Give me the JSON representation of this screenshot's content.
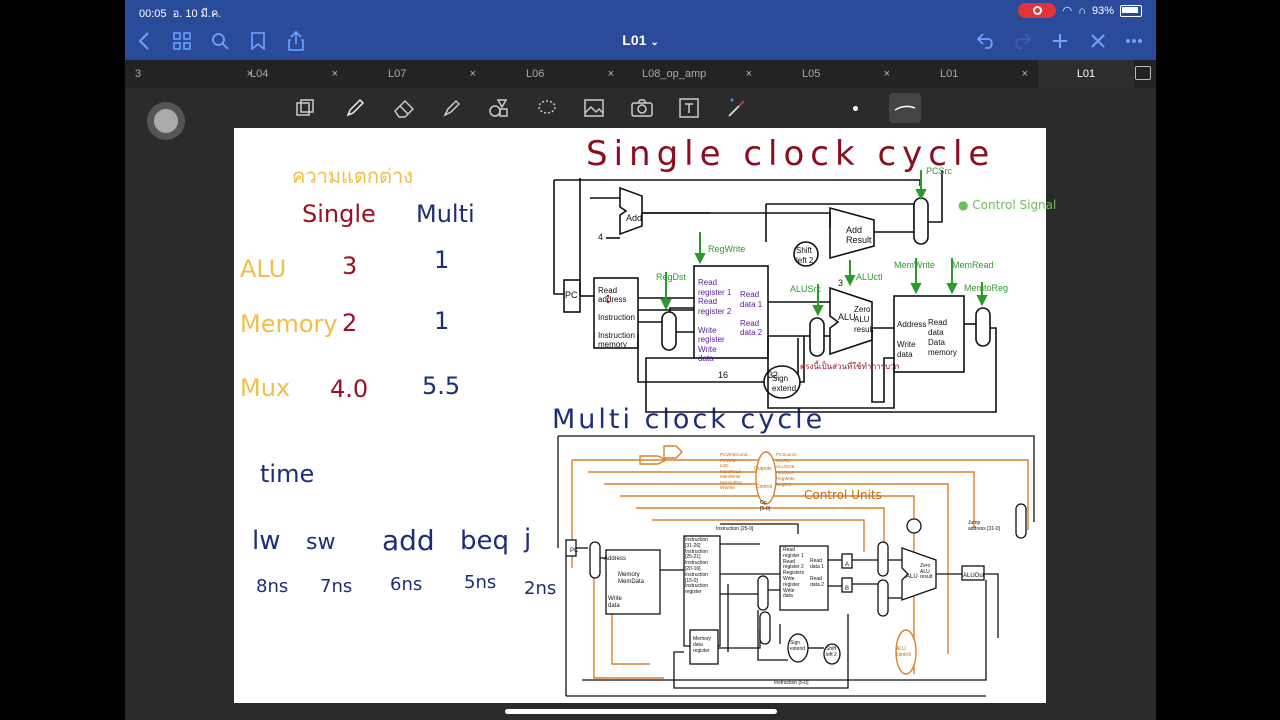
{
  "status": {
    "time": "00:05",
    "date": "อ. 10 มี.ค.",
    "battery": "93%"
  },
  "nav": {
    "doc_title": "L01",
    "chevron": "⌄"
  },
  "tabs": [
    {
      "label": "3",
      "close": "×"
    },
    {
      "label": "L04",
      "close": "×"
    },
    {
      "label": "L07",
      "close": "×"
    },
    {
      "label": "L06",
      "close": "×"
    },
    {
      "label": "L08_op_amp",
      "close": "×"
    },
    {
      "label": "L05",
      "close": "×"
    },
    {
      "label": "L01",
      "close": "×"
    },
    {
      "label": "L01",
      "close": ""
    }
  ],
  "notes": {
    "heading_th": "ความแตกต่าง",
    "col_single": "Single",
    "col_multi": "Multi",
    "rows": [
      {
        "name": "ALU",
        "single": "3",
        "multi": "1"
      },
      {
        "name": "Memory",
        "single": "2",
        "multi": "1"
      },
      {
        "name": "Mux",
        "single": "4.0",
        "multi": "5.5"
      }
    ],
    "time_label": "time",
    "instructions": [
      "lw",
      "sw",
      "add",
      "beq",
      "j"
    ],
    "times": [
      "8ns",
      "7ns",
      "6ns",
      "5ns",
      "2ns"
    ],
    "single_title": "Single  clock  cycle",
    "multi_title": "Multi  clock  cycle",
    "control_signal": "Control Signal",
    "control_units": "Control Units",
    "alu_note": "ตรงนี้เป็นส่วนที่ใช้ทำการบวก"
  },
  "single_diagram": {
    "signals": [
      "PCSrc",
      "RegWrite",
      "RegDst",
      "ALUSrc",
      "ALUctl",
      "MemWrite",
      "MemRead",
      "MemtoReg"
    ],
    "blocks": {
      "add": "Add",
      "add_result": "Add\nResult",
      "shift": "Shift\nleft 2",
      "pc": "PC",
      "inst_mem": "Read\naddress\n\nInstruction\n\nInstruction\nmemory",
      "regs_left": "Read\nregister 1\nRead\nregister 2\n\nWrite\nregister\nWrite\ndata",
      "regs_right": "Read\ndata 1\n\nRead\ndata 2",
      "alu": "ALU",
      "zero": "Zero\nALU\nresult",
      "data_mem": "Address\n\nWrite\ndata",
      "data_mem_r": "Read\ndata\nData\nmemory",
      "sign": "Sign\nextend",
      "mux": "Mux",
      "four": "4",
      "three": "3",
      "sixteen": "16",
      "thirtytwo": "32"
    }
  },
  "multi_diagram": {
    "labels": {
      "memory": "Memory\nMemData",
      "address": "Address",
      "write_data": "Write\ndata",
      "instr_reg": "Instruction\n[31-26]\nInstruction\n[25-21]\nInstruction\n[20-16]\nInstruction\n[15-0]\nInstruction\nregister",
      "registers": "Read\nregister 1\nRead\nregister 2\nRegisters\nWrite\nregister\nWrite\ndata",
      "read_data": "Read\ndata 1\n\nRead\ndata 2",
      "a": "A",
      "b": "B",
      "alu": "ALU",
      "zero": "Zero\nALU\nresult",
      "aluout": "ALUOut",
      "mdr": "Memory\ndata\nregister",
      "sign": "Sign\nextend",
      "shift": "Shift\nleft 2",
      "alu_control": "ALU\ncontrol",
      "jump": "Jump\naddress [31-0]",
      "outputs": "Outputs",
      "control": "Control",
      "op": "Op\n[5-0]",
      "instr_2500": "Instruction [25-0]",
      "instr_50": "Instruction [5-0]",
      "pc": "PC",
      "ctrl_left": [
        "PCWriteCond",
        "PCWrite",
        "IorD",
        "MemRead",
        "MemWrite",
        "MemtoReg",
        "IRWrite"
      ],
      "ctrl_right": [
        "PCSource",
        "ALUOp",
        "ALUSrcB",
        "ALUSrcA",
        "RegWrite",
        "RegDst"
      ]
    }
  }
}
